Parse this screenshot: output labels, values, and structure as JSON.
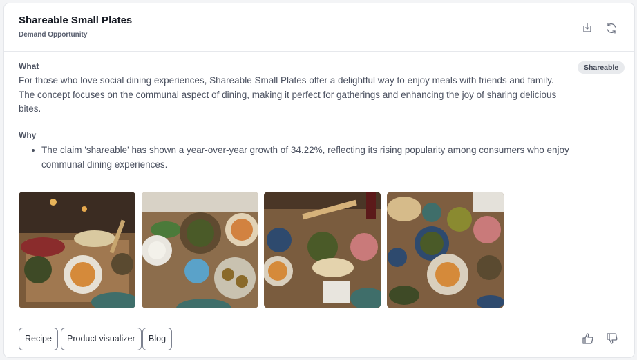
{
  "header": {
    "title": "Shareable Small Plates",
    "subtitle": "Demand Opportunity",
    "icons": [
      "export-icon",
      "refresh-icon"
    ]
  },
  "what": {
    "label": "What",
    "text": "For those who love social dining experiences, Shareable Small Plates offer a delightful way to enjoy meals with friends and family. The concept focuses on the communal aspect of dining, making it perfect for gatherings and enhancing the joy of sharing delicious bites."
  },
  "tag": {
    "label": "Shareable"
  },
  "why": {
    "label": "Why",
    "items": [
      "The claim 'shareable' has shown a year-over-year growth of 34.22%, reflecting its rising popularity among consumers who enjoy communal dining experiences."
    ]
  },
  "images": [
    {
      "name": "small-plates-image-1"
    },
    {
      "name": "small-plates-image-2"
    },
    {
      "name": "small-plates-image-3"
    },
    {
      "name": "small-plates-image-4"
    }
  ],
  "actions": {
    "recipe": "Recipe",
    "product_visualizer": "Product visualizer",
    "blog": "Blog"
  },
  "feedback": {
    "icons": [
      "thumbs-up-icon",
      "thumbs-down-icon"
    ]
  },
  "colors": {
    "accent_text": "#161a23",
    "body_text": "#4b5160",
    "tag_bg": "#e8eaed"
  }
}
